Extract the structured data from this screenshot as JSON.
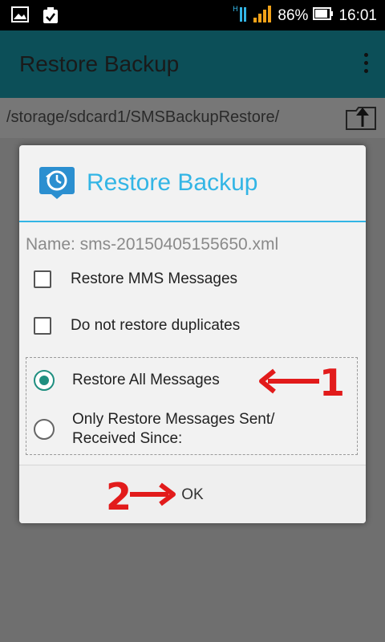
{
  "status_bar": {
    "battery_percent": "86%",
    "time": "16:01",
    "network_label": "H"
  },
  "app": {
    "title": "Restore Backup",
    "path": "/storage/sdcard1/SMSBackupRestore/"
  },
  "dialog": {
    "title": "Restore Backup",
    "file_name": "Name: sms-20150405155650.xml",
    "checkboxes": [
      {
        "label": "Restore MMS Messages",
        "checked": false
      },
      {
        "label": "Do not restore duplicates",
        "checked": false
      }
    ],
    "radios": [
      {
        "label": "Restore All Messages",
        "selected": true
      },
      {
        "label": "Only Restore Messages Sent/\nReceived Since:",
        "selected": false
      }
    ],
    "ok_label": "OK"
  },
  "annotations": {
    "step1": "1",
    "step2": "2",
    "color": "#e21b1b"
  },
  "colors": {
    "accent": "#33b5e5",
    "radio_checked": "#1f8f80",
    "appbar": "#0c4f58"
  }
}
